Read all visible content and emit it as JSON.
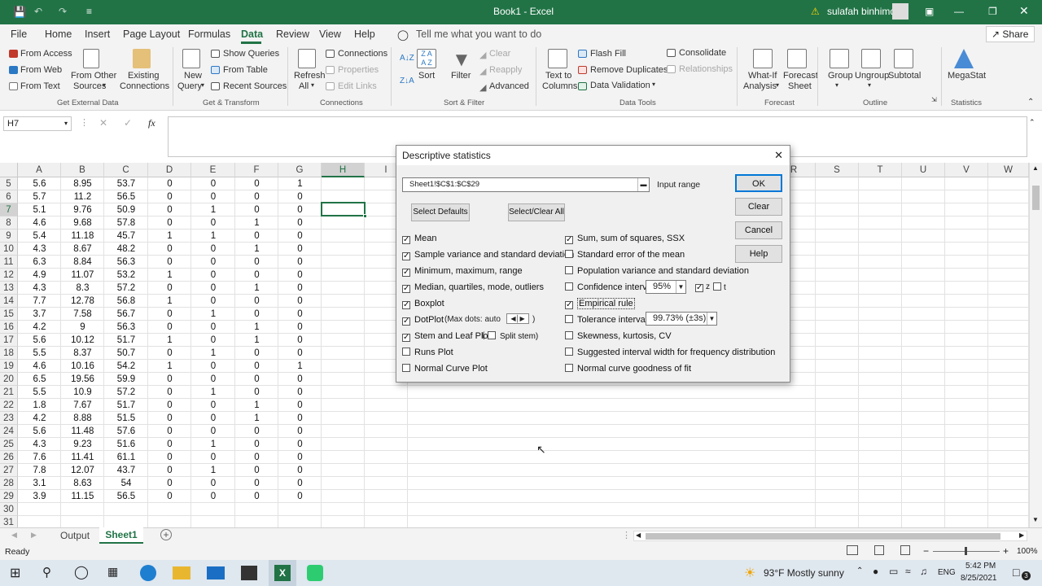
{
  "window": {
    "title": "Book1 - Excel",
    "user": "sulafah binhimd",
    "share": "Share",
    "tell_me": "Tell me what you want to do"
  },
  "menu": [
    "File",
    "Home",
    "Insert",
    "Page Layout",
    "Formulas",
    "Data",
    "Review",
    "View",
    "Help"
  ],
  "ribbon": {
    "get_external": {
      "from_access": "From Access",
      "from_web": "From Web",
      "from_text": "From Text",
      "from_other": "From Other",
      "sources": "Sources",
      "existing": "Existing",
      "connections": "Connections",
      "label": "Get External Data"
    },
    "get_transform": {
      "new": "New",
      "query": "Query",
      "show_queries": "Show Queries",
      "from_table": "From Table",
      "recent_sources": "Recent Sources",
      "label": "Get & Transform"
    },
    "connections": {
      "refresh": "Refresh",
      "all": "All",
      "connections": "Connections",
      "properties": "Properties",
      "edit_links": "Edit Links",
      "label": "Connections"
    },
    "sort_filter": {
      "sort": "Sort",
      "filter": "Filter",
      "clear": "Clear",
      "reapply": "Reapply",
      "advanced": "Advanced",
      "label": "Sort & Filter"
    },
    "data_tools": {
      "text_to": "Text to",
      "columns": "Columns",
      "flash_fill": "Flash Fill",
      "remove_duplicates": "Remove Duplicates",
      "data_validation": "Data Validation",
      "consolidate": "Consolidate",
      "relationships": "Relationships",
      "label": "Data Tools"
    },
    "forecast": {
      "whatif": "What-If",
      "analysis": "Analysis",
      "forecast": "Forecast",
      "sheet": "Sheet",
      "label": "Forecast"
    },
    "outline": {
      "group": "Group",
      "ungroup": "Ungroup",
      "subtotal": "Subtotal",
      "label": "Outline"
    },
    "statistics": {
      "megastat": "MegaStat",
      "label": "Statistics"
    }
  },
  "formula": {
    "namebox": "H7",
    "fx": "fx"
  },
  "columns": [
    "A",
    "B",
    "C",
    "D",
    "E",
    "F",
    "G",
    "H",
    "I",
    "R",
    "S",
    "T",
    "U",
    "V",
    "W"
  ],
  "rows": [
    {
      "n": "5",
      "v": [
        "5.6",
        "8.95",
        "53.7",
        "0",
        "0",
        "0",
        "1"
      ]
    },
    {
      "n": "6",
      "v": [
        "5.7",
        "11.2",
        "56.5",
        "0",
        "0",
        "0",
        "0"
      ]
    },
    {
      "n": "7",
      "v": [
        "5.1",
        "9.76",
        "50.9",
        "0",
        "1",
        "0",
        "0"
      ]
    },
    {
      "n": "8",
      "v": [
        "4.6",
        "9.68",
        "57.8",
        "0",
        "0",
        "1",
        "0"
      ]
    },
    {
      "n": "9",
      "v": [
        "5.4",
        "11.18",
        "45.7",
        "1",
        "1",
        "0",
        "0"
      ]
    },
    {
      "n": "10",
      "v": [
        "4.3",
        "8.67",
        "48.2",
        "0",
        "0",
        "1",
        "0"
      ]
    },
    {
      "n": "11",
      "v": [
        "6.3",
        "8.84",
        "56.3",
        "0",
        "0",
        "0",
        "0"
      ]
    },
    {
      "n": "12",
      "v": [
        "4.9",
        "11.07",
        "53.2",
        "1",
        "0",
        "0",
        "0"
      ]
    },
    {
      "n": "13",
      "v": [
        "4.3",
        "8.3",
        "57.2",
        "0",
        "0",
        "1",
        "0"
      ]
    },
    {
      "n": "14",
      "v": [
        "7.7",
        "12.78",
        "56.8",
        "1",
        "0",
        "0",
        "0"
      ]
    },
    {
      "n": "15",
      "v": [
        "3.7",
        "7.58",
        "56.7",
        "0",
        "1",
        "0",
        "0"
      ]
    },
    {
      "n": "16",
      "v": [
        "4.2",
        "9",
        "56.3",
        "0",
        "0",
        "1",
        "0"
      ]
    },
    {
      "n": "17",
      "v": [
        "5.6",
        "10.12",
        "51.7",
        "1",
        "0",
        "1",
        "0"
      ]
    },
    {
      "n": "18",
      "v": [
        "5.5",
        "8.37",
        "50.7",
        "0",
        "1",
        "0",
        "0"
      ]
    },
    {
      "n": "19",
      "v": [
        "4.6",
        "10.16",
        "54.2",
        "1",
        "0",
        "0",
        "1"
      ]
    },
    {
      "n": "20",
      "v": [
        "6.5",
        "19.56",
        "59.9",
        "0",
        "0",
        "0",
        "0"
      ]
    },
    {
      "n": "21",
      "v": [
        "5.5",
        "10.9",
        "57.2",
        "0",
        "1",
        "0",
        "0"
      ]
    },
    {
      "n": "22",
      "v": [
        "1.8",
        "7.67",
        "51.7",
        "0",
        "0",
        "1",
        "0"
      ]
    },
    {
      "n": "23",
      "v": [
        "4.2",
        "8.88",
        "51.5",
        "0",
        "0",
        "1",
        "0"
      ]
    },
    {
      "n": "24",
      "v": [
        "5.6",
        "11.48",
        "57.6",
        "0",
        "0",
        "0",
        "0"
      ]
    },
    {
      "n": "25",
      "v": [
        "4.3",
        "9.23",
        "51.6",
        "0",
        "1",
        "0",
        "0"
      ]
    },
    {
      "n": "26",
      "v": [
        "7.6",
        "11.41",
        "61.1",
        "0",
        "0",
        "0",
        "0"
      ]
    },
    {
      "n": "27",
      "v": [
        "7.8",
        "12.07",
        "43.7",
        "0",
        "1",
        "0",
        "0"
      ]
    },
    {
      "n": "28",
      "v": [
        "3.1",
        "8.63",
        "54",
        "0",
        "0",
        "0",
        "0"
      ]
    },
    {
      "n": "29",
      "v": [
        "3.9",
        "11.15",
        "56.5",
        "0",
        "0",
        "0",
        "0"
      ]
    },
    {
      "n": "30",
      "v": [
        "",
        "",
        "",
        "",
        "",
        "",
        ""
      ]
    },
    {
      "n": "31",
      "v": [
        "",
        "",
        "",
        "",
        "",
        "",
        ""
      ]
    }
  ],
  "dialog": {
    "title": "Descriptive statistics",
    "input_range_value": "Sheet1!$C$1:$C$29",
    "input_range_label": "Input range",
    "select_defaults": "Select Defaults",
    "select_clear_all": "Select/Clear All",
    "ok": "OK",
    "clear": "Clear",
    "cancel": "Cancel",
    "help": "Help",
    "left": [
      {
        "label": "Mean",
        "checked": true
      },
      {
        "label": "Sample variance and standard deviation",
        "checked": true
      },
      {
        "label": "Minimum, maximum, range",
        "checked": true
      },
      {
        "label": "Median, quartiles, mode, outliers",
        "checked": true
      },
      {
        "label": "Boxplot",
        "checked": true
      },
      {
        "label": "DotPlot",
        "checked": true
      },
      {
        "label": "Stem and Leaf Plot",
        "checked": true
      },
      {
        "label": "Runs Plot",
        "checked": false
      },
      {
        "label": "Normal Curve Plot",
        "checked": false
      }
    ],
    "right": [
      {
        "label": "Sum, sum of squares, SSX",
        "checked": true
      },
      {
        "label": "Standard error of the mean",
        "checked": false
      },
      {
        "label": "Population variance and standard deviation",
        "checked": false
      },
      {
        "label": "Confidence interval",
        "checked": false
      },
      {
        "label": "Empirical rule",
        "checked": true
      },
      {
        "label": "Tolerance interval",
        "checked": false
      },
      {
        "label": "Skewness, kurtosis, CV",
        "checked": false
      },
      {
        "label": "Suggested interval width for frequency distribution",
        "checked": false
      },
      {
        "label": "Normal curve goodness of fit",
        "checked": false
      }
    ],
    "max_dots": "(Max dots: auto",
    "close_paren": ")",
    "split_stem_open": "(",
    "split_stem": "Split stem)",
    "confidence_value": "95%",
    "z_label": "z",
    "t_label": "t",
    "tolerance_value": "99.73% (±3s)"
  },
  "tabs": {
    "output": "Output",
    "sheet1": "Sheet1"
  },
  "status": {
    "ready": "Ready",
    "zoom": "100%"
  },
  "taskbar": {
    "weather": "93°F  Mostly sunny",
    "lang": "ENG",
    "time": "5:42 PM",
    "date": "8/25/2021",
    "notif": "3"
  }
}
